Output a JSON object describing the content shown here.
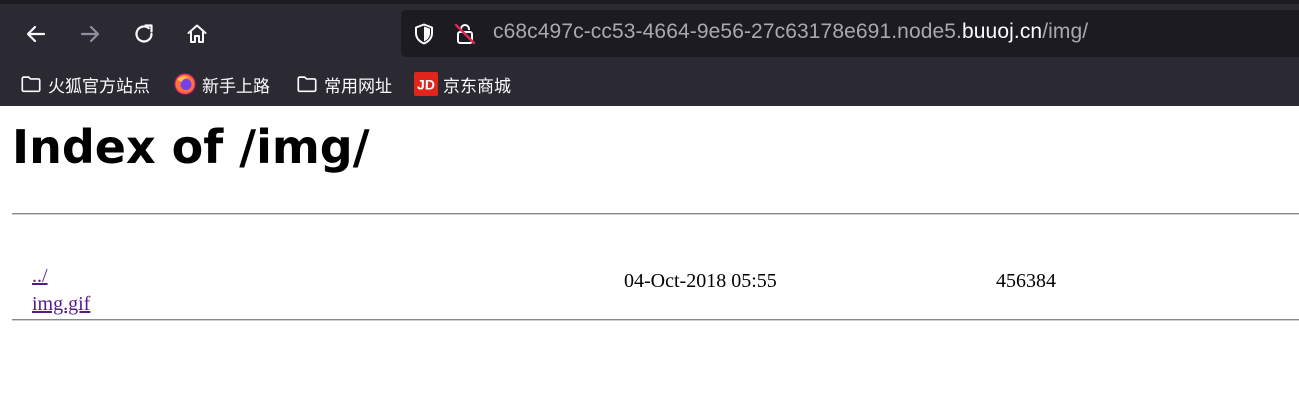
{
  "browser": {
    "url_prefix": "c68c497c-cc53-4664-9e56-27c63178e691.node5.",
    "url_domain": "buuoj.cn",
    "url_path": "/img/",
    "nav": {
      "back_icon": "arrow-left-icon",
      "forward_icon": "arrow-right-icon",
      "reload_icon": "reload-icon",
      "home_icon": "home-icon"
    },
    "bookmarks": [
      {
        "label": "火狐官方站点",
        "icon": "folder-icon"
      },
      {
        "label": "新手上路",
        "icon": "firefox-icon"
      },
      {
        "label": "常用网址",
        "icon": "folder-icon"
      },
      {
        "label": "京东商城",
        "icon": "jd-icon",
        "icon_text": "JD",
        "icon_color": "#e1251b"
      }
    ]
  },
  "page": {
    "title": "Index of /img/",
    "entries": [
      {
        "name": "../",
        "date": "",
        "size": ""
      },
      {
        "name": "img.gif",
        "date": "04-Oct-2018 05:55",
        "size": "456384"
      }
    ]
  },
  "colors": {
    "chrome_bg": "#2b2a33",
    "urlbar_bg": "#1c1b22",
    "visited_link": "#551a8b"
  }
}
